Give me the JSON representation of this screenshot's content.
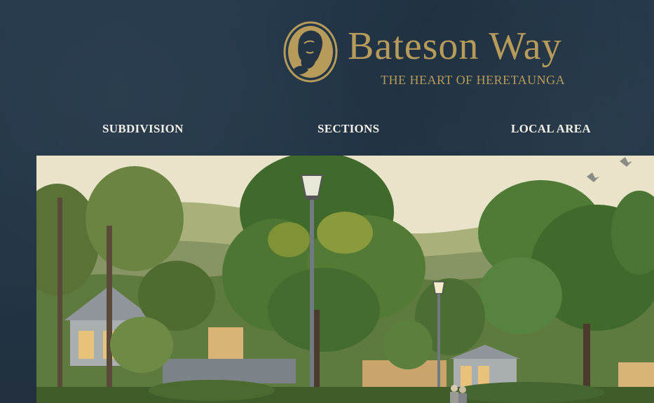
{
  "brand": {
    "title": "Bateson Way",
    "subtitle": "THE HEART OF HERETAUNGA",
    "logo_icon": "portrait-medallion-icon",
    "gold": "#b79b5b"
  },
  "nav": {
    "items": [
      {
        "label": "SUBDIVISION"
      },
      {
        "label": "SECTIONS"
      },
      {
        "label": "LOCAL AREA"
      }
    ]
  },
  "hero": {
    "image": "neighbourhood-street-illustration",
    "sky": "#e9e4c9",
    "foliage": "#4e6a34"
  },
  "colors": {
    "background": "#233545",
    "nav_text": "#f2efe6"
  }
}
